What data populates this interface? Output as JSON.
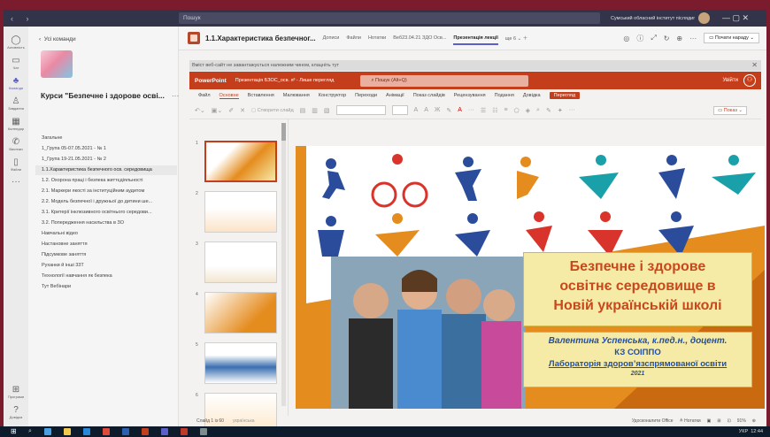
{
  "titlebar": {
    "search": "Пошук",
    "org": "Сумський обласний інститут післядипло..."
  },
  "rail": [
    {
      "icon": "bell-icon",
      "label": "Активність"
    },
    {
      "icon": "chat-icon",
      "label": "Чат"
    },
    {
      "icon": "teams-icon",
      "label": "Команди"
    },
    {
      "icon": "assignments-icon",
      "label": "Завдання"
    },
    {
      "icon": "calendar-icon",
      "label": "Календар"
    },
    {
      "icon": "calls-icon",
      "label": "Виклики"
    },
    {
      "icon": "files-icon",
      "label": "Файли"
    },
    {
      "icon": "more-icon",
      "label": ""
    },
    {
      "icon": "apps-icon",
      "label": "Програми"
    },
    {
      "icon": "help-icon",
      "label": "Довідка"
    }
  ],
  "pane": {
    "back": "Усі команди",
    "team_name": "Курси \"Безпечне і здорове осві...",
    "channels": [
      "Загальне",
      "1_Група 05-07.05.2021 - № 1",
      "1_Група 19-21.05.2021 - № 2",
      "1.1.Характеристика безпечного осв. середовища",
      "1.2. Охорона праці і безпека життєдіяльності",
      "2.1. Маркери якості за інституційним аудитом",
      "2.2. Модель безпечної і дружньої до дитини ше...",
      "3.1. Критерії інклюзивного освітнього середови...",
      "3.2. Попередження насильства в ЗО",
      "Навчальні відео",
      "Настановне заняття",
      "Підсумкове заняття",
      "Руханки й інші 33Т",
      "Технології навчання як безпека",
      "Тут Вебінари"
    ]
  },
  "header": {
    "title": "1.1.Характеристика безпечног...",
    "tabs": [
      "Дописи",
      "Файли",
      "Нотатки",
      "Веб23.04.21 ЗДО Осв...",
      "Презентація лекції",
      "ще 6"
    ],
    "meet": "Почати нараду"
  },
  "infobar": "Вміст веб-сайт не завантажується належним чином, клацніть тут",
  "ppt": {
    "brand": "PowerPoint",
    "doc": "Презентація БЗОС_осв. я³ - Лише перегляд",
    "search": "Пошук (Alt+Q)",
    "exit": "Увійти",
    "tabs": [
      "Файл",
      "Основне",
      "Вставлення",
      "Малювання",
      "Конструктор",
      "Переходи",
      "Анімації",
      "Показ слайдів",
      "Рецензування",
      "Подання",
      "Довідка"
    ],
    "view_btn": "Перегляд",
    "show_btn": "Показ",
    "new_slide": "Створити слайд",
    "bold": "Ж"
  },
  "slides": [
    "1",
    "2",
    "3",
    "4",
    "5",
    "6"
  ],
  "slide": {
    "title_lines": [
      "Безпечне і здорове",
      "освітнє середовище в",
      "Новій українській школі"
    ],
    "author": "Валентина Успенська, к.пед.н., доцент.",
    "org": "КЗ СОІППО",
    "lab": "Лабораторія здоров’язспрямованої освіти",
    "year": "2021"
  },
  "status": {
    "slide": "Слайд 1 із 60",
    "lang": "українська",
    "improve": "Удосконалити Office",
    "notes": "Нотатки",
    "zoom": "91%"
  },
  "taskbar": {
    "lang": "УКР",
    "time": "12:44"
  },
  "colors": {
    "accent": "#c43e1c",
    "teams": "#5b5fc7",
    "titlebar": "#33344a"
  }
}
